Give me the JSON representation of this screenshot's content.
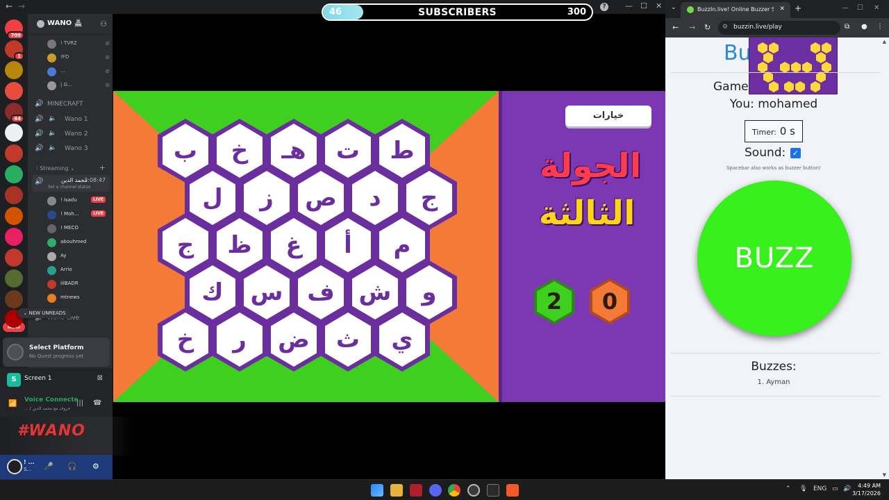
{
  "discord": {
    "subscriber_bar": {
      "current": "46",
      "label": "SUBSCRIBERS",
      "goal": "300",
      "progress_fraction": 0.15
    },
    "servers": [
      {
        "name": "home",
        "color": "#f23f43",
        "badge": "709"
      },
      {
        "name": "server-2",
        "color": "#c0392b",
        "badge": "1"
      },
      {
        "name": "server-3",
        "color": "#b8860b",
        "badge": ""
      },
      {
        "name": "server-4",
        "color": "#e74c3c",
        "badge": ""
      },
      {
        "name": "server-5",
        "color": "#8e2b2b",
        "badge": "44"
      },
      {
        "name": "server-6",
        "color": "#ecf0f1",
        "badge": ""
      },
      {
        "name": "server-7",
        "color": "#c0392b",
        "badge": ""
      },
      {
        "name": "server-8",
        "color": "#27ae60",
        "badge": ""
      },
      {
        "name": "server-9",
        "color": "#a93226",
        "badge": ""
      },
      {
        "name": "server-10",
        "color": "#d35400",
        "badge": ""
      },
      {
        "name": "server-11",
        "color": "#e91e63",
        "badge": ""
      },
      {
        "name": "server-12",
        "color": "#c0392b",
        "badge": ""
      },
      {
        "name": "server-13",
        "color": "#556b2f",
        "badge": ""
      },
      {
        "name": "server-14",
        "color": "#6b3a1a",
        "badge": ""
      },
      {
        "name": "server-15",
        "color": "#a00",
        "badge": ""
      }
    ],
    "new_label": "NEW",
    "server_name": "WANO 🏯",
    "top_voice_users": [
      {
        "name": "! TVRZ",
        "color": "#777"
      },
      {
        "name": "!FD",
        "color": "#c59a2f"
      },
      {
        "name": "...",
        "color": "#4a7bd0"
      },
      {
        "name": "| G...",
        "color": "#999"
      }
    ],
    "channels": {
      "minecraft": "MINECRAFT",
      "wano1": "Wano 1",
      "wano2": "Wano 2",
      "wano3": "Wano 3",
      "streaming_cat": "Streaming",
      "live_channel_name": "محمد الدين",
      "live_channel_time": "3:08:47",
      "live_channel_status": "Set a channel status",
      "wano_live": "Wano Live",
      "unreads": "NEW UNREADS"
    },
    "stream_users": [
      {
        "name": "! isadu",
        "color": "#888",
        "live": "LIVE"
      },
      {
        "name": "! Moh...",
        "color": "#2a4a8a",
        "live": "LIVE"
      },
      {
        "name": "! MECO",
        "color": "#666",
        "live": ""
      },
      {
        "name": "abouhmed",
        "color": "#3a6",
        "live": ""
      },
      {
        "name": "Ay",
        "color": "#aaa",
        "live": ""
      },
      {
        "name": "Arrio",
        "color": "#2a9d8f",
        "live": ""
      },
      {
        "name": "iiiBADR",
        "color": "#c0392b",
        "live": ""
      },
      {
        "name": "mtnews",
        "color": "#e67e22",
        "live": ""
      }
    ],
    "platform": {
      "title": "Select Platform",
      "subtitle": "No Quest progress yet"
    },
    "screen_share": {
      "label": "Screen 1"
    },
    "voice": {
      "title": "Voice Connecte",
      "subtitle": "... / حروف مع محمد الدين"
    },
    "banner_text": "#WANO",
    "user": {
      "name": "! ...",
      "status": "S..."
    }
  },
  "game": {
    "colors": {
      "green": "#3fcf1e",
      "orange": "#f47a38",
      "purple": "#7c37b2",
      "hex_border": "#6a2e9f"
    },
    "rows": [
      [
        "ط",
        "ت",
        "هـ",
        "خ",
        "ب"
      ],
      [
        "ج",
        "د",
        "ص",
        "ز",
        "ل"
      ],
      [
        "م",
        "أ",
        "غ",
        "ظ",
        "ج"
      ],
      [
        "و",
        "ش",
        "ف",
        "س",
        "ك"
      ],
      [
        "ي",
        "ث",
        "ض",
        "ر",
        "خ"
      ]
    ],
    "options_label": "خيارات",
    "round_title": "الجولة",
    "round_subtitle": "الثالثة",
    "scores": [
      {
        "value": "2",
        "color": "#3fcf1e",
        "border": "#2b8a16"
      },
      {
        "value": "0",
        "color": "#f47a38",
        "border": "#b44a18"
      }
    ]
  },
  "browser": {
    "tab_title": "BuzzIn.live! Online Buzzer System",
    "url": "buzzin.live/play",
    "page": {
      "title": "Bu",
      "game_label": "Game",
      "you": "You: mohamed",
      "timer_label": "Timer:",
      "timer_value": "0 s",
      "sound_label": "Sound:",
      "sound_enabled": true,
      "hint": "Spacebar also works as buzzer button!",
      "buzz_label": "BUZZ",
      "buzzes_title": "Buzzes:",
      "buzzes": [
        "1. Ayman"
      ]
    }
  },
  "taskbar": {
    "lang": "ENG",
    "time": "4:49 AM",
    "date": "3/17/2026"
  }
}
